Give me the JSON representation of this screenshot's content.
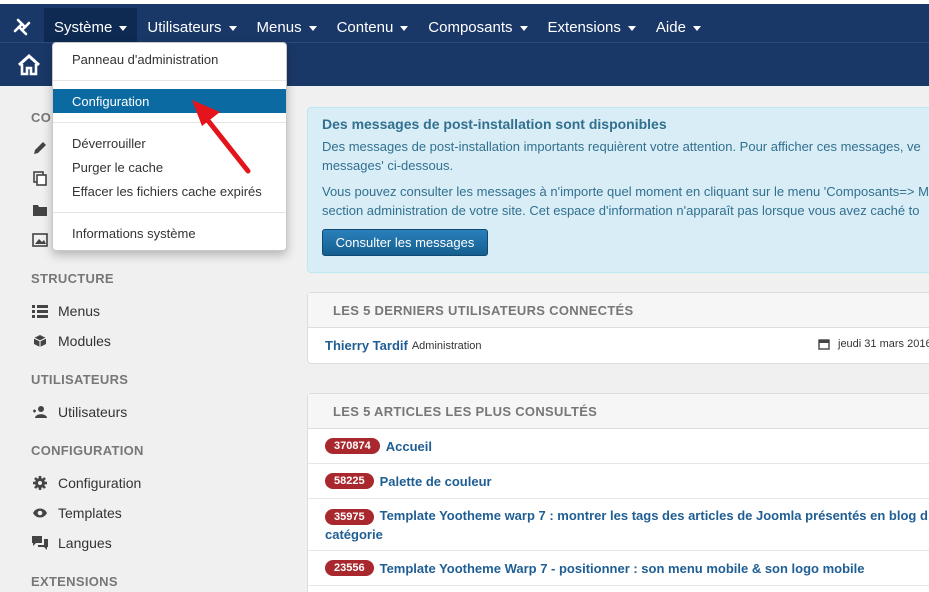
{
  "topnav": {
    "items": [
      {
        "label": "Système",
        "active": true
      },
      {
        "label": "Utilisateurs"
      },
      {
        "label": "Menus"
      },
      {
        "label": "Contenu"
      },
      {
        "label": "Composants"
      },
      {
        "label": "Extensions"
      },
      {
        "label": "Aide"
      }
    ]
  },
  "dropdown": {
    "items": [
      "Panneau d'administration",
      "Configuration",
      "Déverrouiller",
      "Purger le cache",
      "Effacer les fichiers cache expirés",
      "Informations système"
    ],
    "selected": "Configuration"
  },
  "sidebar": {
    "partial_heading": "CO",
    "structure_heading": "STRUCTURE",
    "menus": "Menus",
    "modules": "Modules",
    "users_heading": "UTILISATEURS",
    "users": "Utilisateurs",
    "config_heading": "CONFIGURATION",
    "configuration": "Configuration",
    "templates": "Templates",
    "languages": "Langues",
    "extensions_heading": "EXTENSIONS"
  },
  "alert": {
    "title": "Des messages de post-installation sont disponibles",
    "line1": "Des messages de post-installation importants requièrent votre attention. Pour afficher ces messages, ve",
    "line2": "messages' ci-dessous.",
    "line3": "Vous pouvez consulter les messages à n'importe quel moment en cliquant sur le menu 'Composants=> M",
    "line4": "section administration de votre site. Cet espace d'information n'apparaît pas lorsque vous avez caché to",
    "button": "Consulter les messages"
  },
  "users_panel": {
    "title": "LES 5 DERNIERS UTILISATEURS CONNECTÉS",
    "user": "Thierry Tardif",
    "role": "Administration",
    "date": "jeudi 31 mars 2016"
  },
  "articles_panel": {
    "title": "LES 5 ARTICLES LES PLUS CONSULTÉS",
    "articles": [
      {
        "hits": "370874",
        "title": "Accueil"
      },
      {
        "hits": "58225",
        "title": "Palette de couleur"
      },
      {
        "hits": "35975",
        "title": "Template Yootheme warp 7 : montrer les tags des articles de Joomla présentés en blog d",
        "title2": "catégorie"
      },
      {
        "hits": "23556",
        "title": "Template Yootheme Warp 7 - positionner : son menu mobile & son logo mobile"
      }
    ]
  },
  "colors": {
    "navbar": "#1a3867",
    "accent": "#0b6aa1",
    "badge": "#a8282d",
    "alert_bg": "#d9edf7",
    "arrow": "#e3141b"
  }
}
